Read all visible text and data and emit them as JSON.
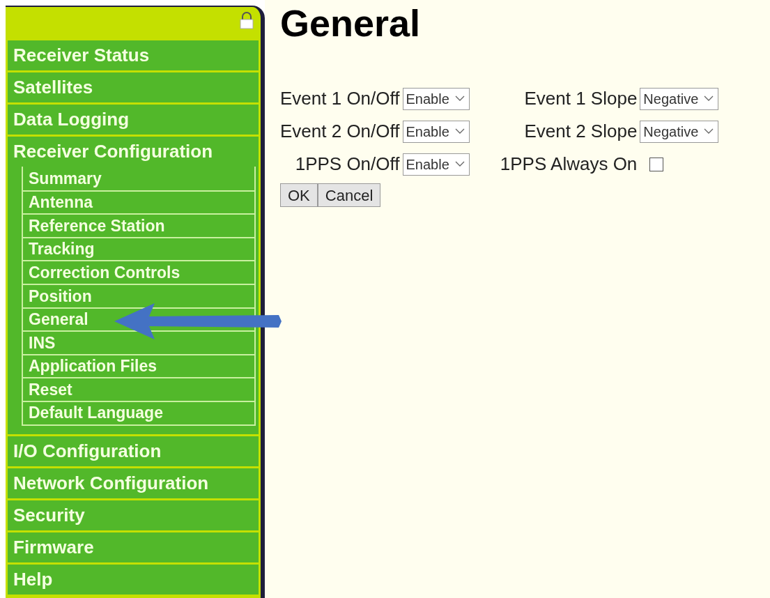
{
  "sidebar": {
    "items": [
      {
        "label": "Receiver Status"
      },
      {
        "label": "Satellites"
      },
      {
        "label": "Data Logging"
      },
      {
        "label": "Receiver Configuration",
        "children": [
          {
            "label": "Summary"
          },
          {
            "label": "Antenna"
          },
          {
            "label": "Reference Station"
          },
          {
            "label": "Tracking"
          },
          {
            "label": "Correction Controls"
          },
          {
            "label": "Position"
          },
          {
            "label": "General"
          },
          {
            "label": "INS"
          },
          {
            "label": "Application Files"
          },
          {
            "label": "Reset"
          },
          {
            "label": "Default Language"
          }
        ]
      },
      {
        "label": "I/O Configuration"
      },
      {
        "label": "Network Configuration"
      },
      {
        "label": "Security"
      },
      {
        "label": "Firmware"
      },
      {
        "label": "Help"
      }
    ]
  },
  "page_title": "General",
  "form": {
    "rows": [
      [
        {
          "kind": "select",
          "label": "Event 1 On/Off",
          "value": "Enable"
        },
        {
          "kind": "select",
          "label": "Event 1 Slope",
          "value": "Negative"
        }
      ],
      [
        {
          "kind": "select",
          "label": "Event 2 On/Off",
          "value": "Enable"
        },
        {
          "kind": "select",
          "label": "Event 2 Slope",
          "value": "Negative"
        }
      ],
      [
        {
          "kind": "select",
          "label": "1PPS On/Off",
          "value": "Enable"
        },
        {
          "kind": "checkbox",
          "label": "1PPS Always On",
          "checked": false
        }
      ]
    ]
  },
  "buttons": [
    "OK",
    "Cancel"
  ]
}
